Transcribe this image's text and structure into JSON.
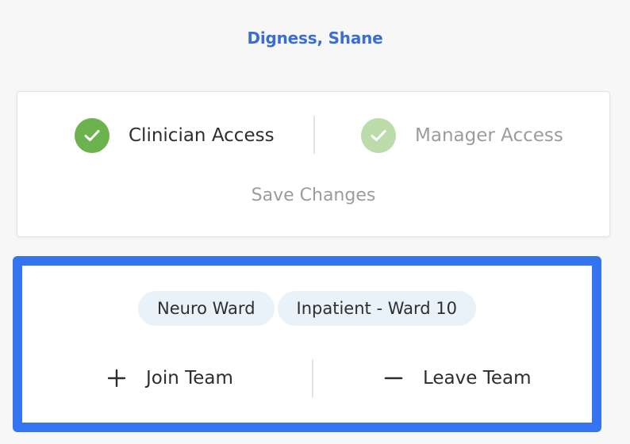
{
  "user": {
    "name": "Digness, Shane"
  },
  "access": {
    "clinician_label": "Clinician Access",
    "manager_label": "Manager Access",
    "clinician_checked": true,
    "manager_checked": true,
    "save_label": "Save Changes"
  },
  "teams": {
    "tags": [
      "Neuro Ward",
      "Inpatient - Ward 10"
    ],
    "join_label": "Join Team",
    "leave_label": "Leave Team"
  },
  "colors": {
    "name_link": "#3a6fd0",
    "check_active": "#6cb24e",
    "check_inactive": "#bcdcab",
    "highlight_border": "#3574f0",
    "tag_background": "#e9f2f9"
  },
  "icons": {
    "clinician_check": "check-icon",
    "manager_check": "check-icon",
    "join": "plus-icon",
    "leave": "minus-icon"
  }
}
